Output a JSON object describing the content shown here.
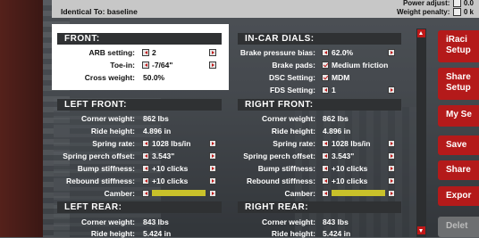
{
  "header": {
    "identical_to": "Identical To: baseline",
    "power_adjust_label": "Power adjust:",
    "power_adjust_value": "0.0",
    "weight_penalty_label": "Weight penalty:",
    "weight_penalty_value": "0 k"
  },
  "front": {
    "title": "FRONT:",
    "arb_label": "ARB setting:",
    "arb_value": "2",
    "toe_label": "Toe-in:",
    "toe_value": "-7/64\"",
    "cross_label": "Cross weight:",
    "cross_value": "50.0%"
  },
  "incar": {
    "title": "IN-CAR DIALS:",
    "bpb_label": "Brake pressure bias:",
    "bpb_value": "62.0%",
    "pads_label": "Brake pads:",
    "pads_value": "Medium friction",
    "dsc_label": "DSC Setting:",
    "dsc_value": "MDM",
    "fds_label": "FDS Setting:",
    "fds_value": "1"
  },
  "left_front": {
    "title": "LEFT FRONT:",
    "corner_label": "Corner weight:",
    "corner_value": "862 lbs",
    "ride_label": "Ride height:",
    "ride_value": "4.896 in",
    "spring_label": "Spring rate:",
    "spring_value": "1028 lbs/in",
    "perch_label": "Spring perch offset:",
    "perch_value": "3.543\"",
    "bump_label": "Bump stiffness:",
    "bump_value": "+10 clicks",
    "rebound_label": "Rebound stiffness:",
    "rebound_value": "+10 clicks",
    "camber_label": "Camber:"
  },
  "right_front": {
    "title": "RIGHT FRONT:",
    "corner_label": "Corner weight:",
    "corner_value": "862 lbs",
    "ride_label": "Ride height:",
    "ride_value": "4.896 in",
    "spring_label": "Spring rate:",
    "spring_value": "1028 lbs/in",
    "perch_label": "Spring perch offset:",
    "perch_value": "3.543\"",
    "bump_label": "Bump stiffness:",
    "bump_value": "+10 clicks",
    "rebound_label": "Rebound stiffness:",
    "rebound_value": "+10 clicks",
    "camber_label": "Camber:"
  },
  "left_rear": {
    "title": "LEFT REAR:",
    "corner_label": "Corner weight:",
    "corner_value": "843 lbs",
    "ride_label": "Ride height:",
    "ride_value": "5.424 in"
  },
  "right_rear": {
    "title": "RIGHT REAR:",
    "corner_label": "Corner weight:",
    "corner_value": "843 lbs",
    "ride_label": "Ride height:",
    "ride_value": "5.424 in"
  },
  "buttons": {
    "iracing_l1": "iRaci",
    "iracing_l2": "Setup",
    "shared_l1": "Share",
    "shared_l2": "Setup",
    "my_setups": "My Se",
    "save": "Save",
    "share": "Share",
    "export": "Expor",
    "delete": "Delet"
  },
  "colors": {
    "accent": "#b41a1a",
    "camber_bar": "#c9c12a",
    "header_bar": "#2f3133"
  }
}
